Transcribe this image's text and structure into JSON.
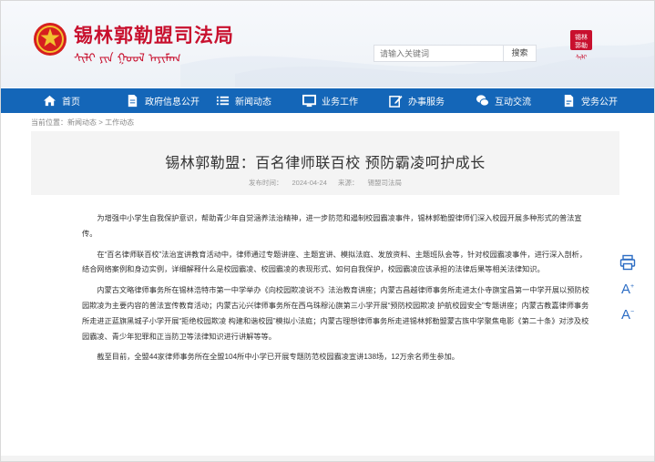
{
  "header": {
    "site_title": "锡林郭勒盟司法局",
    "mongol_subtitle": "ᠰᠢᠯᠢ ᠶᠢᠨ ᠭᠣᠣᠯ ᠠᠶᠢᠮᠠᠭ",
    "search": {
      "placeholder": "请输入关键词",
      "button_label": "搜索"
    },
    "seal_text": [
      "锡林",
      "郭勒"
    ]
  },
  "nav": {
    "items": [
      {
        "label": "首页",
        "icon": "home-icon"
      },
      {
        "label": "政府信息公开",
        "icon": "document-icon"
      },
      {
        "label": "新闻动态",
        "icon": "list-icon"
      },
      {
        "label": "业务工作",
        "icon": "monitor-icon"
      },
      {
        "label": "办事服务",
        "icon": "edit-icon"
      },
      {
        "label": "互动交流",
        "icon": "chat-icon"
      },
      {
        "label": "党务公开",
        "icon": "doc-icon"
      }
    ]
  },
  "breadcrumb": {
    "prefix": "当前位置：",
    "items": [
      "新闻动态",
      "工作动态"
    ],
    "separator": " > "
  },
  "article": {
    "title": "锡林郭勒盟：百名律师联百校 预防霸凌呵护成长",
    "publish_label": "发布时间：",
    "publish_date": "2024-04-24",
    "source_label": "来源：",
    "source": "锡盟司法局",
    "paragraphs": [
      "为增强中小学生自我保护意识，帮助青少年自觉涵养法治精神，进一步防范和遏制校园霸凌事件，锡林郭勒盟律师们深入校园开展多种形式的普法宣传。",
      "在“百名律师联百校”法治宣讲教育活动中，律师通过专题讲座、主题宣讲、模拟法庭、发放资料、主题班队会等，针对校园霸凌事件，进行深入剖析，结合网络案例和身边实例，详细解释什么是校园霸凌、校园霸凌的表现形式、如何自我保护，校园霸凌应该承担的法律后果等相关法律知识。",
      "内蒙古文略律师事务所在锡林浩特市第一中学举办《向校园欺凌说不》法治教育讲座；内蒙古昌越律师事务所走进太仆寺旗宝昌第一中学开展以预防校园欺凌为主要内容的普法宣传教育活动；内蒙古沁兴律师事务所在西乌珠穆沁旗第三小学开展“预防校园欺凌 护航校园安全”专题讲座；内蒙古教嘉律师事务所走进正蓝旗黑城子小学开展“拒绝校园欺凌 构建和谐校园”模拟小法庭；内蒙古理想律师事务所走进锡林郭勒盟蒙古族中学聚焦电影《第二十条》对涉及校园霸凌、青少年犯罪和正当防卫等法律知识进行讲解等等。",
      "截至目前，全盟44家律师事务所在全盟104所中小学已开展专题防范校园霸凌宣讲138场，12万余名师生参加。"
    ]
  },
  "tools": {
    "print": "print-icon",
    "font_increase": "A",
    "font_decrease": "A"
  },
  "colors": {
    "brand_red": "#c8102e",
    "nav_blue": "#1466b8",
    "tool_blue": "#2b6cc4"
  }
}
